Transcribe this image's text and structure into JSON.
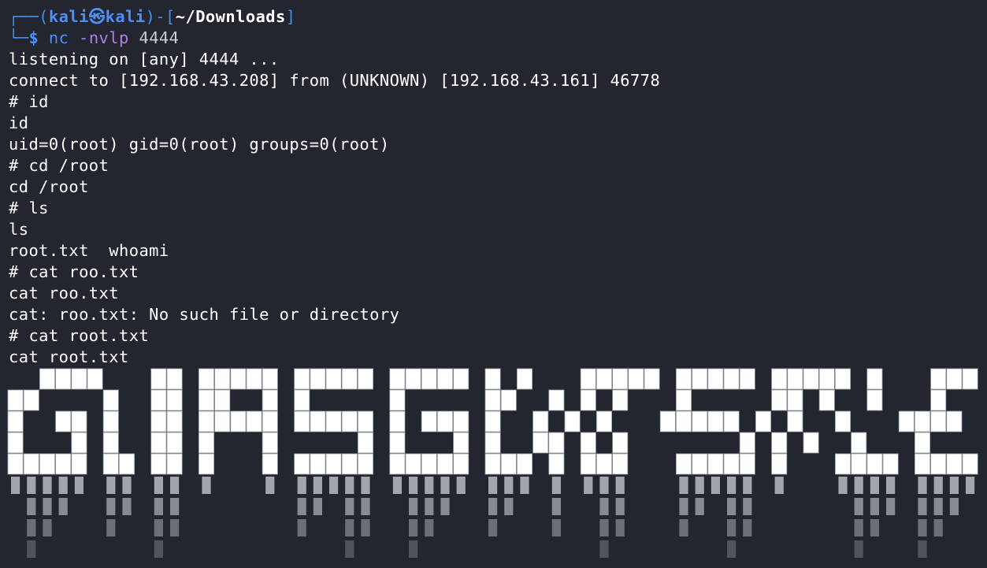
{
  "prompt": {
    "corner_top": "┌──(",
    "user": "kali",
    "skull": "㉿",
    "host": "kali",
    "mid": ")-[",
    "path": "~/Downloads",
    "end": "]",
    "corner_bottom": "└─",
    "dollar": "$",
    "command": "nc",
    "option": "-nvlp",
    "argument": "4444"
  },
  "output_lines": [
    "listening on [any] 4444 ...",
    "connect to [192.168.43.208] from (UNKNOWN) [192.168.43.161] 46778",
    "# id",
    "id",
    "uid=0(root) gid=0(root) groups=0(root)",
    "# cd /root",
    "cd /root",
    "# ls",
    "ls",
    "root.txt  whoami",
    "# cat roo.txt",
    "cat roo.txt",
    "cat: roo.txt: No such file or directory",
    "# cat root.txt",
    "cat root.txt"
  ],
  "banner": {
    "ascii_rows": [
      "  ████   ██ █████ █████ █████ █ █   █████ █████ █████ █   █████",
      "██    █  ██ ██  █ █     █     ██  █ █ █   █     ██ █  █   █",
      "█  ██ █  ██ █████ █████ █ ███ █  █ █ █   █████ █ █  █   ████",
      "█   █ █  ██ █   █     █ █   █ █  ██ █ █       █ █ █  █   █",
      "█████ ██ ██ █   █ █████ █████ ███ █ ███   █████ █   ████ ████"
    ],
    "block_color": "#ffffff",
    "shade_color": "#b9bcc2"
  },
  "colors": {
    "background": "#23262f",
    "prompt_blue": "#3b8eea",
    "option_purple": "#b07fe0"
  }
}
